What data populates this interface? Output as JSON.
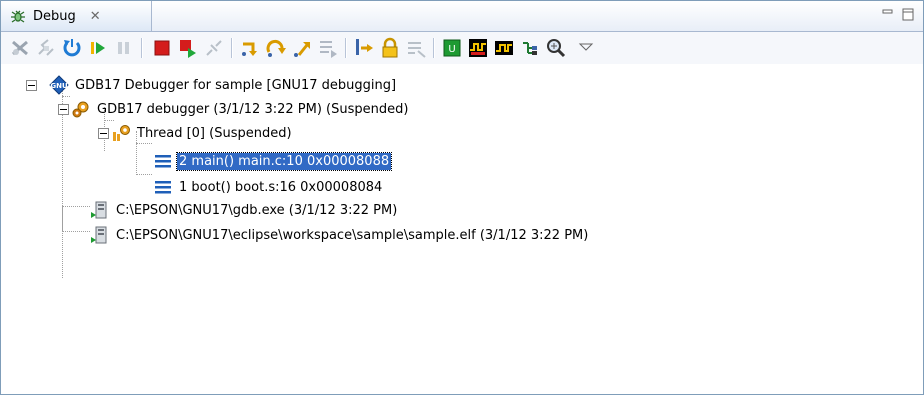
{
  "tab": {
    "label": "Debug",
    "close_symbol": "✕"
  },
  "tree": {
    "launch": "GDB17 Debugger for sample [GNU17 debugging]",
    "debugger": "GDB17 debugger (3/1/12 3:22 PM) (Suspended)",
    "thread": "Thread [0] (Suspended)",
    "frame1": "2 main() main.c:10 0x00008088",
    "frame2": "1 boot() boot.s:16 0x00008084",
    "process1": "C:\\EPSON\\GNU17\\gdb.exe (3/1/12 3:22 PM)",
    "process2": "C:\\EPSON\\GNU17\\eclipse\\workspace\\sample\\sample.elf (3/1/12 3:22 PM)"
  },
  "colors": {
    "selection": "#316ac5",
    "accent_green": "#1e9a32",
    "terminate_red": "#d41c1c"
  },
  "icons": {
    "toolbar": [
      "remove-terminated-icon",
      "connect-icon",
      "restart-icon",
      "resume-icon",
      "suspend-icon",
      "terminate-icon",
      "terminate-relaunch-icon",
      "disconnect-icon",
      "step-into-icon",
      "step-over-icon",
      "step-return-icon",
      "drop-to-frame-icon",
      "instruction-stepping-icon",
      "lock-icon",
      "step-filters-icon",
      "reset-icon",
      "waveform-icon",
      "signal-icon",
      "tree-icon",
      "magnify-icon",
      "view-menu-icon"
    ]
  }
}
